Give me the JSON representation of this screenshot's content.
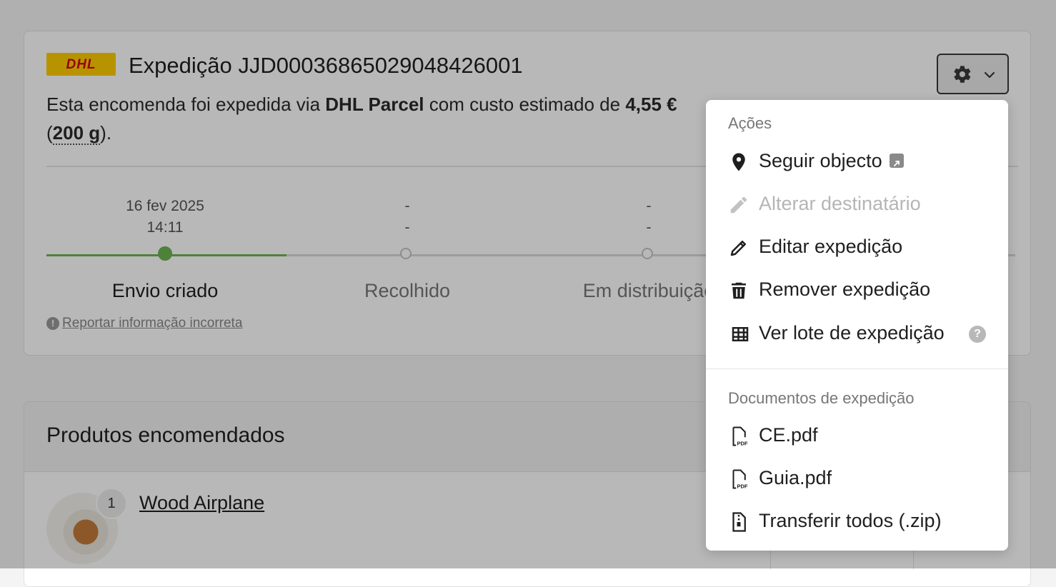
{
  "shipment": {
    "carrier_logo_text": "DHL",
    "title": "Expedição JJD0003686502904842600 1",
    "title_clean": "Expedição JJD0003686502904842600",
    "title_full": "Expedição JJD000368650290484260 01",
    "desc_prefix": "Esta encomenda foi expedida via ",
    "carrier_name": "DHL Parcel",
    "desc_middle": " com custo estimado de ",
    "cost": "4,55 €",
    "weight_open": "(",
    "weight": "200 g",
    "weight_close": ")."
  },
  "timeline": [
    {
      "date": "16 fev 2025",
      "time": "14:11",
      "label": "Envio criado",
      "done": true
    },
    {
      "date": "-",
      "time": "-",
      "label": "Recolhido",
      "done": false
    },
    {
      "date": "-",
      "time": "-",
      "label": "Em distribuição",
      "done": false
    }
  ],
  "report_link": "Reportar informação incorreta",
  "products": {
    "heading": "Produtos encomendados",
    "items": [
      {
        "qty": "1",
        "name": "Wood Airplane"
      }
    ]
  },
  "menu": {
    "actions_label": "Ações",
    "items": [
      {
        "label": "Seguir objecto",
        "icon": "map-pin-icon",
        "disabled": false
      },
      {
        "label": "Alterar destinatário",
        "icon": "pencil-icon",
        "disabled": true
      },
      {
        "label": "Editar expedição",
        "icon": "pencil-icon",
        "disabled": false
      },
      {
        "label": "Remover expedição",
        "icon": "trash-icon",
        "disabled": false
      },
      {
        "label": "Ver lote de expedição",
        "icon": "table-icon",
        "disabled": false
      }
    ],
    "docs_label": "Documentos de expedição",
    "docs": [
      {
        "label": "CE.pdf",
        "icon": "pdf-file-icon"
      },
      {
        "label": "Guia.pdf",
        "icon": "pdf-file-icon"
      },
      {
        "label": "Transferir todos (.zip)",
        "icon": "zip-file-icon"
      }
    ]
  }
}
